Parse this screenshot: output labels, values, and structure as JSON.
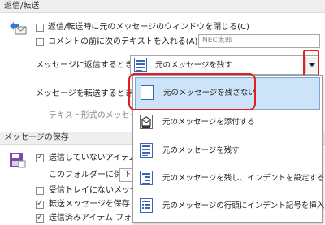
{
  "sections": {
    "reply_forward": "返信/転送",
    "save_messages": "メッセージの保存"
  },
  "reply": {
    "close_window_label": "返信/転送時に元のメッセージのウィンドウを閉じる(C)",
    "preface_label_prefix": "コメントの前に次のテキストを入れる(",
    "preface_key": "A",
    "preface_label_suffix": "):",
    "preface_value": "NEC太郎",
    "reply_label": "メッセージに返信するとき(R):",
    "reply_selected": "元のメッセージを残す",
    "forward_label": "メッセージを転送するとき(F):",
    "plaintext_label": "テキスト形式のメッセージの"
  },
  "dropdown_options": [
    {
      "label": "元のメッセージを残さない",
      "icon": "no-original-icon"
    },
    {
      "label": "元のメッセージを添付する",
      "icon": "attach-original-icon"
    },
    {
      "label": "元のメッセージを残す",
      "icon": "include-original-icon"
    },
    {
      "label": "元のメッセージを残し、インデントを設定する",
      "icon": "include-indent-icon"
    },
    {
      "label": "元のメッセージの行頭にインデント記号を挿入する",
      "icon": "prefix-lines-icon"
    }
  ],
  "save": {
    "unsent_label": "送信していないアイテムを次",
    "folder_label": "このフォルダーに保存(F):",
    "folder_value_fragment": "下",
    "inbox_label": "受信トレイにないメッセージに",
    "forwarded_label": "転送メッセージを保存する(",
    "sent_folder_label": "送信済みアイテム フォルダー"
  },
  "colors": {
    "highlight_border": "#e02020",
    "accent_blue": "#3c64b4",
    "section_bg": "#efefef"
  }
}
